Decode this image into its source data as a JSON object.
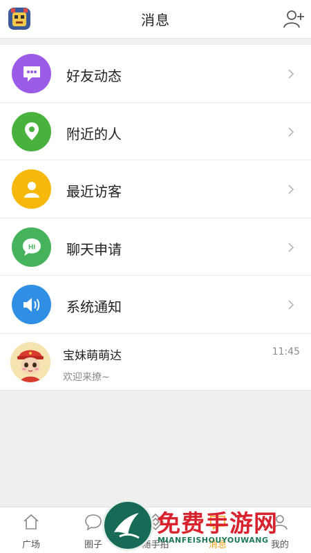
{
  "header": {
    "title": "消息"
  },
  "menu": [
    {
      "label": "好友动态",
      "color": "#9b5be7",
      "icon": "chat-bubble-icon"
    },
    {
      "label": "附近的人",
      "color": "#49b23f",
      "icon": "location-pin-icon"
    },
    {
      "label": "最近访客",
      "color": "#f6b80a",
      "icon": "person-icon"
    },
    {
      "label": "聊天申请",
      "color": "#44b35b",
      "icon": "hi-bubble-icon",
      "icon_text": "HI"
    },
    {
      "label": "系统通知",
      "color": "#2f8fe4",
      "icon": "speaker-icon"
    }
  ],
  "chat": {
    "name": "宝妹萌萌达",
    "message": "欢迎来撩~",
    "time": "11:45"
  },
  "tabs": [
    {
      "label": "广场",
      "icon": "home-icon"
    },
    {
      "label": "圈子",
      "icon": "chat-icon"
    },
    {
      "label": "随手拍",
      "icon": "diamond-icon"
    },
    {
      "label": "消息",
      "icon": "message-icon"
    },
    {
      "label": "我的",
      "icon": "user-icon"
    }
  ],
  "watermark": {
    "title": "免费手游网",
    "subtitle": "MIANFEISHOUYOUWANG"
  }
}
